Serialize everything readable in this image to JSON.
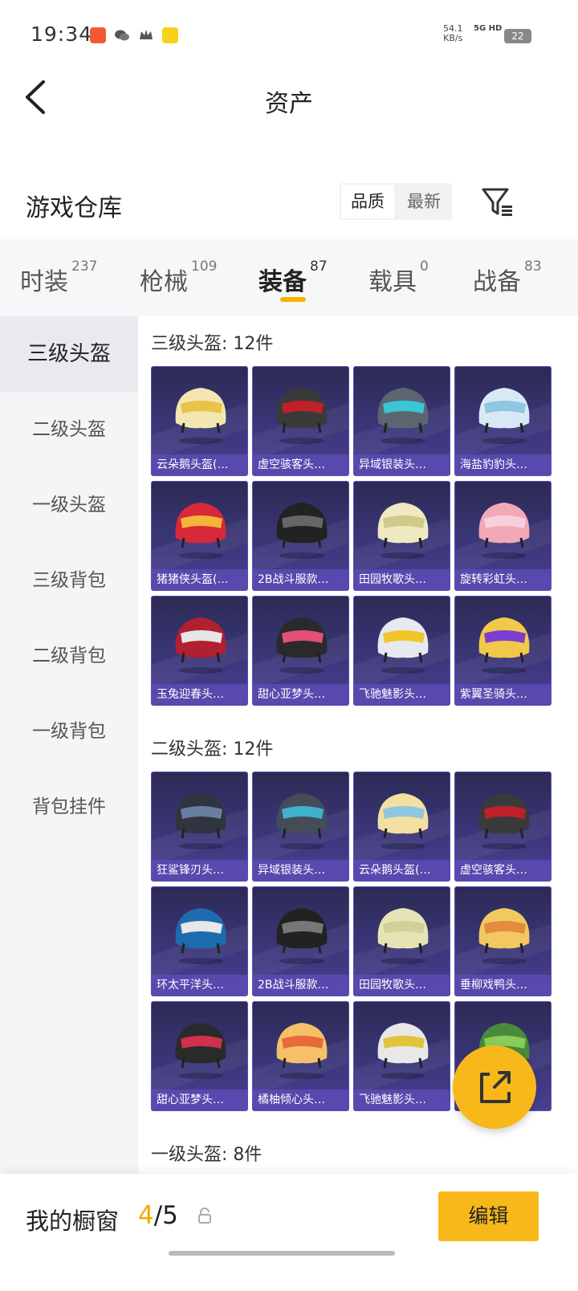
{
  "status_bar": {
    "time": "19:34",
    "net_speed": "54.1",
    "net_unit": "KB/s",
    "signal": "5G HD",
    "battery": "22",
    "icons": [
      "app-notification-icon",
      "wechat-icon",
      "crown-icon",
      "game-app-icon"
    ]
  },
  "header": {
    "back_icon": "chevron-left-icon",
    "title": "资产"
  },
  "warehouse": {
    "title": "游戏仓库",
    "sort_options": [
      "品质",
      "最新"
    ],
    "sort_selected": "品质",
    "filter_icon": "filter-icon"
  },
  "tabs": [
    {
      "label": "时装",
      "count": "237"
    },
    {
      "label": "枪械",
      "count": "109"
    },
    {
      "label": "装备",
      "count": "87"
    },
    {
      "label": "载具",
      "count": "0"
    },
    {
      "label": "战备",
      "count": "83"
    }
  ],
  "active_tab": "装备",
  "sidebar": [
    "三级头盔",
    "二级头盔",
    "一级头盔",
    "三级背包",
    "二级背包",
    "一级背包",
    "背包挂件"
  ],
  "sidebar_active": "三级头盔",
  "groups": [
    {
      "title": "三级头盔: 12件",
      "items": [
        "云朵鹅头盔(…",
        "虚空骇客头…",
        "异域银装头…",
        "海盐豹豹头…",
        "猪猪侠头盔(…",
        "2B战斗服款…",
        "田园牧歌头…",
        "旋转彩虹头…",
        "玉兔迎春头…",
        "甜心亚梦头…",
        "飞驰魅影头…",
        "紫翼圣骑头…"
      ]
    },
    {
      "title": "二级头盔: 12件",
      "items": [
        "狂鲨锋刃头…",
        "异域银装头…",
        "云朵鹅头盔(…",
        "虚空骇客头…",
        "环太平洋头…",
        "2B战斗服款…",
        "田园牧歌头…",
        "垂柳戏鸭头…",
        "甜心亚梦头…",
        "橘柚倾心头…",
        "飞驰魅影头…",
        ""
      ]
    },
    {
      "title": "一级头盔: 8件",
      "items": []
    }
  ],
  "fab_icon": "share-icon",
  "bottom": {
    "label": "我的橱窗",
    "count_current": "4",
    "count_total": "/5",
    "lock_icon": "lock-icon",
    "edit_label": "编辑"
  },
  "colors": {
    "accent": "#f8b81a",
    "card_bg": "#3b3678",
    "card_label_bg": "#5a4bb4"
  }
}
